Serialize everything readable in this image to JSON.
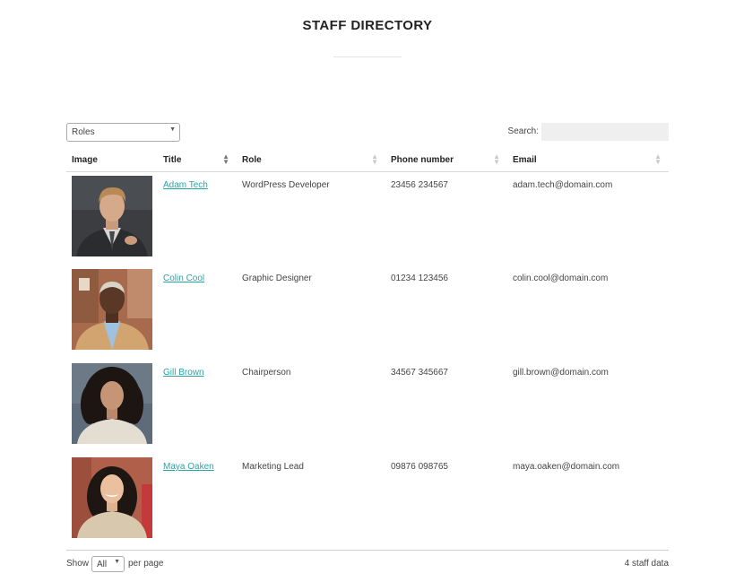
{
  "page": {
    "title": "STAFF DIRECTORY"
  },
  "filters": {
    "roles_selected": "Roles",
    "search_label": "Search:",
    "search_value": ""
  },
  "table": {
    "columns": [
      "Image",
      "Title",
      "Role",
      "Phone number",
      "Email"
    ],
    "rows": [
      {
        "name": "Adam Tech",
        "role": "WordPress Developer",
        "phone": "23456 234567",
        "email": "adam.tech@domain.com"
      },
      {
        "name": "Colin Cool",
        "role": "Graphic Designer",
        "phone": "01234 123456",
        "email": "colin.cool@domain.com"
      },
      {
        "name": "Gill Brown",
        "role": "Chairperson",
        "phone": "34567 345667",
        "email": "gill.brown@domain.com"
      },
      {
        "name": "Maya Oaken",
        "role": "Marketing Lead",
        "phone": "09876 098765",
        "email": "maya.oaken@domain.com"
      }
    ]
  },
  "footer": {
    "show_label": "Show",
    "per_page_value": "All",
    "per_page_label": "per page",
    "count_text": "4 staff data"
  },
  "colors": {
    "link": "#2aa5a5",
    "title": "#222222",
    "search_bg": "#efefef"
  },
  "icons": {
    "dropdown": "chevron-down-icon",
    "sort": "sort-icon",
    "sort_active": "sort-ascending-icon"
  }
}
